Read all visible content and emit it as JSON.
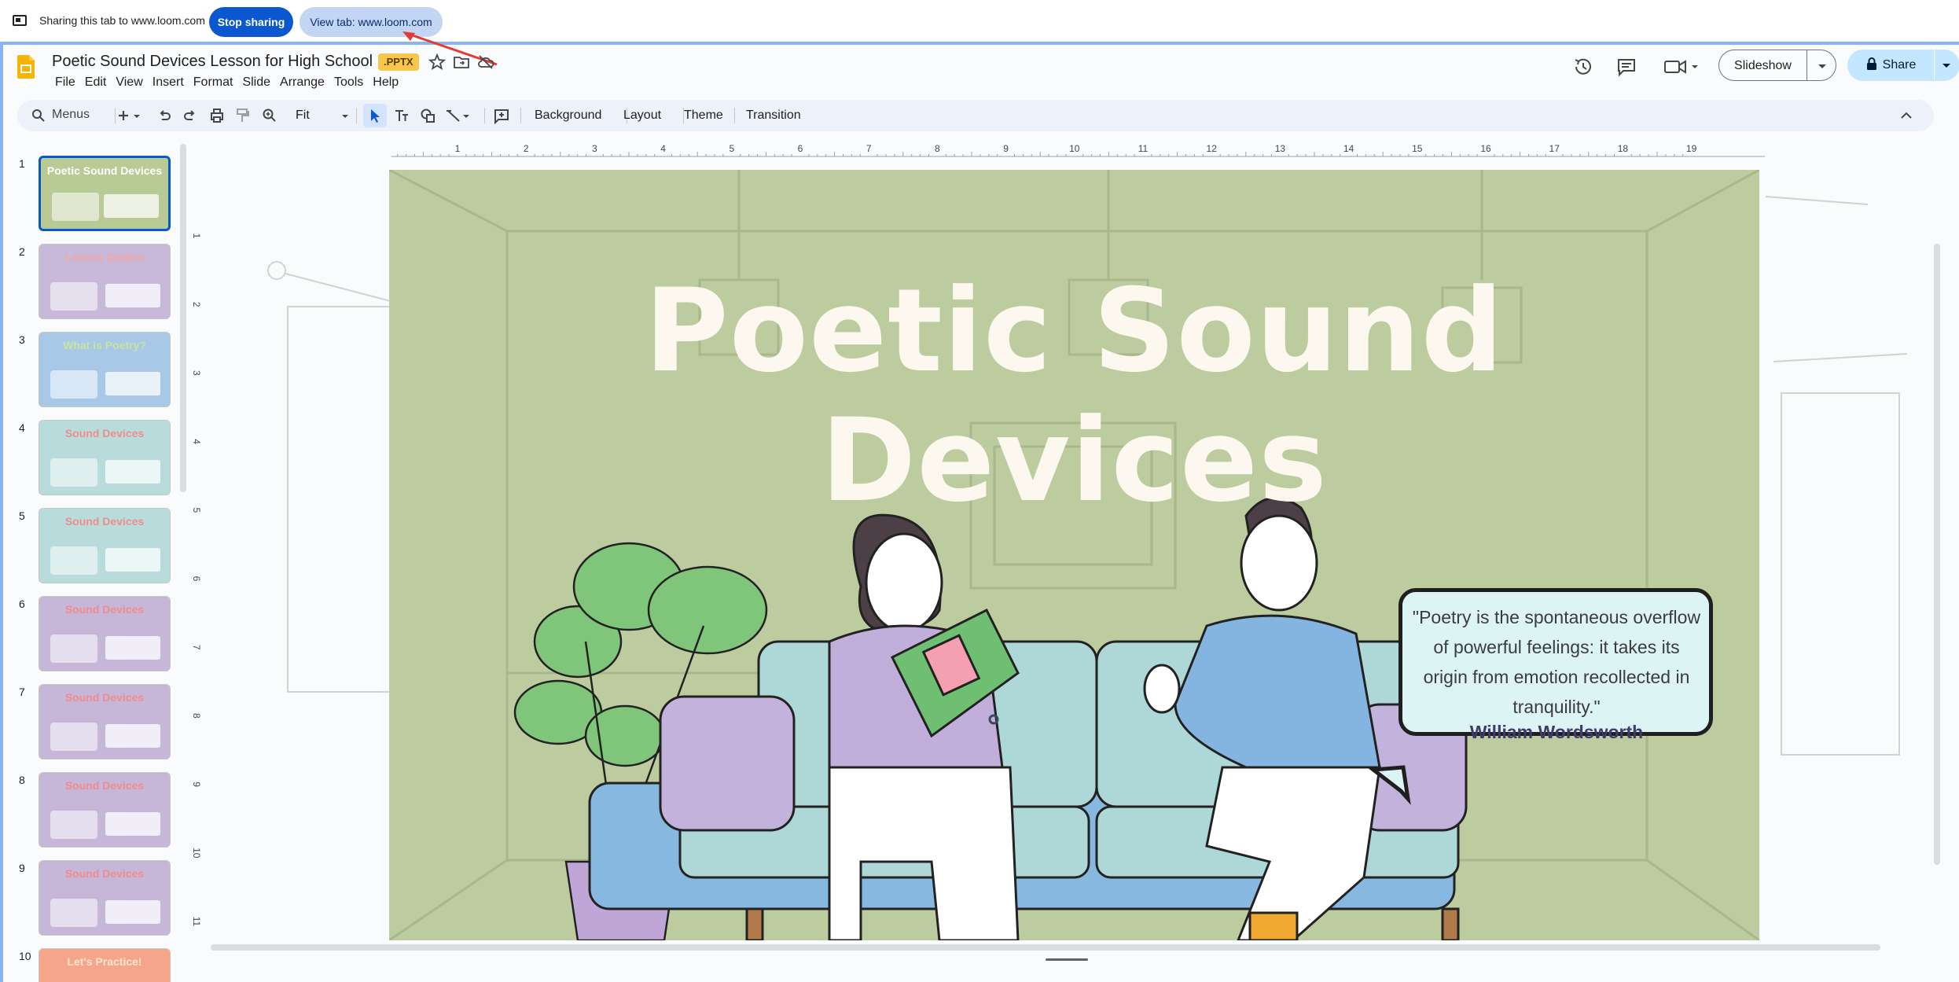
{
  "sharing_bar": {
    "status_text": "Sharing this tab to www.loom.com",
    "stop_label": "Stop sharing",
    "view_label": "View tab: www.loom.com"
  },
  "header": {
    "title": "Poetic Sound Devices Lesson for High School",
    "badge": ".PPTX",
    "menu": [
      "File",
      "Edit",
      "View",
      "Insert",
      "Format",
      "Slide",
      "Arrange",
      "Tools",
      "Help"
    ],
    "slideshow_label": "Slideshow",
    "share_label": "Share"
  },
  "toolbar": {
    "search_label": "Menus",
    "zoom_value": "Fit",
    "background_label": "Background",
    "layout_label": "Layout",
    "theme_label": "Theme",
    "transition_label": "Transition"
  },
  "filmstrip": {
    "slides": [
      {
        "num": "1",
        "title": "Poetic Sound Devices",
        "bg": "#b9cb94",
        "title_color": "#ffffff"
      },
      {
        "num": "2",
        "title": "Lesson Outline",
        "bg": "#c8b8d9",
        "title_color": "#f3a6a6"
      },
      {
        "num": "3",
        "title": "What is Poetry?",
        "bg": "#a8c8e8",
        "title_color": "#c8e39b"
      },
      {
        "num": "4",
        "title": "Sound Devices",
        "bg": "#b8dcdc",
        "title_color": "#f28b8b"
      },
      {
        "num": "5",
        "title": "Sound Devices",
        "bg": "#b8dcdc",
        "title_color": "#f28b8b"
      },
      {
        "num": "6",
        "title": "Sound Devices",
        "bg": "#c6b7d9",
        "title_color": "#f28b8b"
      },
      {
        "num": "7",
        "title": "Sound Devices",
        "bg": "#c6b7d9",
        "title_color": "#f28b8b"
      },
      {
        "num": "8",
        "title": "Sound Devices",
        "bg": "#c6b7d9",
        "title_color": "#f28b8b"
      },
      {
        "num": "9",
        "title": "Sound Devices",
        "bg": "#c6b7d9",
        "title_color": "#f28b8b"
      },
      {
        "num": "10",
        "title": "Let's Practice!",
        "bg": "#f5a58a",
        "title_color": "#fde7c8"
      }
    ]
  },
  "ruler": {
    "horizontal_ticks": [
      "1",
      "2",
      "3",
      "4",
      "5",
      "6",
      "7",
      "8",
      "9",
      "10",
      "11",
      "12",
      "13",
      "14",
      "15",
      "16",
      "17",
      "18",
      "19"
    ],
    "vertical_ticks": [
      "1",
      "2",
      "3",
      "4",
      "5",
      "6",
      "7",
      "8",
      "9",
      "10",
      "11"
    ]
  },
  "slide": {
    "title_line1": "Poetic Sound",
    "title_line2": "Devices",
    "quote": "\"Poetry is the spontaneous overflow of powerful feelings: it takes its origin from emotion recollected in tranquility.\"",
    "author": "William Wordsworth",
    "bg_color": "#bccc9f"
  }
}
